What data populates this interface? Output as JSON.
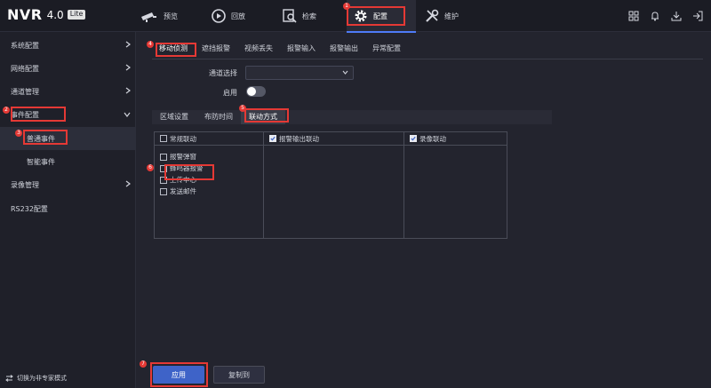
{
  "app": {
    "name": "NVR",
    "version": "4.0",
    "edition": "Lite"
  },
  "nav": {
    "items": [
      {
        "label": "预览",
        "icon": "camera-icon"
      },
      {
        "label": "回放",
        "icon": "playback-icon"
      },
      {
        "label": "检索",
        "icon": "search-icon"
      },
      {
        "label": "配置",
        "icon": "gear-icon",
        "active": true
      },
      {
        "label": "维护",
        "icon": "wrench-icon"
      }
    ],
    "right_icons": [
      "grid-icon",
      "bell-icon",
      "download-icon",
      "export-icon"
    ]
  },
  "sidebar": {
    "items": [
      {
        "label": "系统配置"
      },
      {
        "label": "网络配置"
      },
      {
        "label": "通道管理"
      },
      {
        "label": "事件配置",
        "expanded": true
      },
      {
        "label": "普通事件",
        "selected": true
      },
      {
        "label": "智能事件"
      },
      {
        "label": "录像管理"
      },
      {
        "label": "RS232配置"
      }
    ],
    "footer": "切换为非专家模式"
  },
  "tabs": [
    "移动侦测",
    "遮挡报警",
    "视频丢失",
    "报警输入",
    "报警输出",
    "异常配置"
  ],
  "form": {
    "channel_label": "通道选择",
    "channel_value": "",
    "enable_label": "启用",
    "enabled": false
  },
  "subtabs": [
    "区域设置",
    "布防时间",
    "联动方式"
  ],
  "linkage": {
    "columns": [
      {
        "header": "常规联动",
        "checked": false,
        "options": [
          "报警弹窗",
          "蜂鸣器报警",
          "上传中心",
          "发送邮件"
        ]
      },
      {
        "header": "报警输出联动",
        "checked": true,
        "options": []
      },
      {
        "header": "录像联动",
        "checked": true,
        "options": []
      }
    ]
  },
  "buttons": {
    "apply": "应用",
    "copy": "复制到"
  },
  "annotations": [
    "1",
    "2",
    "3",
    "4",
    "5",
    "6",
    "7"
  ],
  "colors": {
    "accent": "#4e7bf7",
    "highlight": "#e53935"
  }
}
